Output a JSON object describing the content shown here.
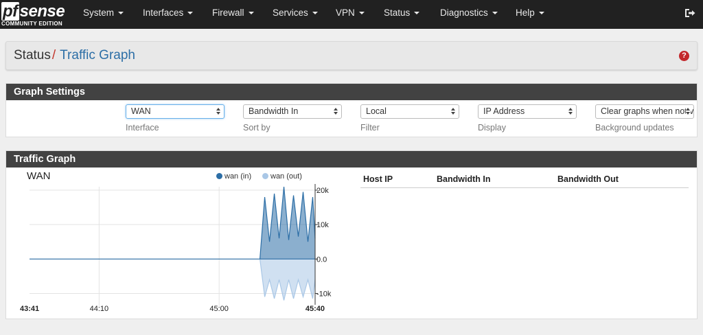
{
  "brand": {
    "name_prefix": "pf",
    "name_suffix": "sense",
    "edition": "COMMUNITY EDITION"
  },
  "nav": {
    "items": [
      {
        "label": "System"
      },
      {
        "label": "Interfaces"
      },
      {
        "label": "Firewall"
      },
      {
        "label": "Services"
      },
      {
        "label": "VPN"
      },
      {
        "label": "Status"
      },
      {
        "label": "Diagnostics"
      },
      {
        "label": "Help"
      }
    ],
    "logout_icon": "logout-icon"
  },
  "breadcrumb": {
    "parent": "Status",
    "separator": "/",
    "current": "Traffic Graph",
    "help_icon": "question-circle-icon",
    "help_glyph": "?"
  },
  "settings": {
    "title": "Graph Settings",
    "fields": [
      {
        "value": "WAN",
        "label": "Interface"
      },
      {
        "value": "Bandwidth In",
        "label": "Sort by"
      },
      {
        "value": "Local",
        "label": "Filter"
      },
      {
        "value": "IP Address",
        "label": "Display"
      },
      {
        "value": "Clear graphs when not visible",
        "label": "Background updates"
      }
    ]
  },
  "traffic": {
    "title": "Traffic Graph",
    "graph_title": "WAN",
    "legend": [
      {
        "name": "wan (in)",
        "color": "#2c6ea6"
      },
      {
        "name": "wan (out)",
        "color": "#a9c7e6"
      }
    ],
    "table_headers": {
      "host_ip": "Host IP",
      "bandwidth_in": "Bandwidth In",
      "bandwidth_out": "Bandwidth Out"
    }
  },
  "chart_data": {
    "type": "area",
    "title": "WAN",
    "xlabel": "",
    "ylabel": "",
    "x_ticks": [
      "43:41",
      "44:10",
      "45:00",
      "45:40"
    ],
    "y_ticks": [
      "20k",
      "10k",
      "0.0",
      "-10k"
    ],
    "ylim": [
      -12500,
      21000
    ],
    "grid": true,
    "legend_position": "top",
    "series": [
      {
        "name": "wan (in)",
        "color": "#2c6ea6",
        "x": [
          "45:17",
          "45:19",
          "45:21",
          "45:23",
          "45:25",
          "45:27",
          "45:29",
          "45:31",
          "45:33",
          "45:35",
          "45:37",
          "45:39",
          "45:40"
        ],
        "values": [
          0,
          18000,
          5000,
          19000,
          6000,
          21000,
          5500,
          18500,
          6500,
          19500,
          5000,
          18000,
          6000
        ]
      },
      {
        "name": "wan (out)",
        "color": "#a9c7e6",
        "x": [
          "45:17",
          "45:19",
          "45:21",
          "45:23",
          "45:25",
          "45:27",
          "45:29",
          "45:31",
          "45:33",
          "45:35",
          "45:37",
          "45:39",
          "45:40"
        ],
        "values": [
          0,
          -11000,
          -6000,
          -11500,
          -6000,
          -12000,
          -6000,
          -11500,
          -6000,
          -11000,
          -6000,
          -11500,
          -6000
        ]
      }
    ]
  }
}
